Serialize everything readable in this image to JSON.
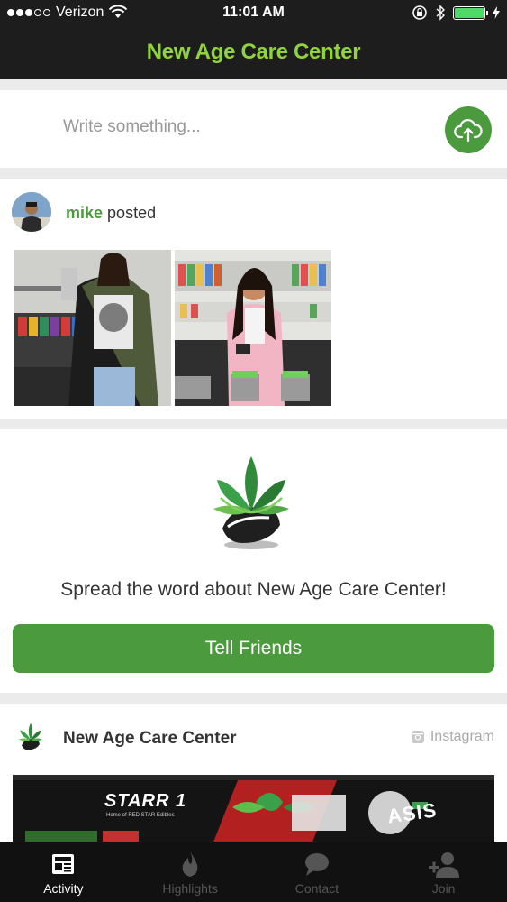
{
  "status_bar": {
    "carrier": "Verizon",
    "time": "11:01 AM",
    "battery_level": 1.0
  },
  "header": {
    "title": "New Age Care Center"
  },
  "composer": {
    "placeholder": "Write something...",
    "upload_icon": "cloud-upload-icon"
  },
  "post": {
    "author": "mike",
    "action": "posted"
  },
  "share": {
    "text": "Spread the word about New Age Care Center!",
    "button_label": "Tell Friends"
  },
  "instagram_post": {
    "account_name": "New Age Care Center",
    "source_label": "Instagram",
    "banner": {
      "starr_title": "STARR 1",
      "starr_subtitle": "Home of RED STAR Edibles",
      "oasis_text": "ASIS"
    }
  },
  "tabs": [
    {
      "label": "Activity",
      "icon": "newspaper-icon",
      "active": true
    },
    {
      "label": "Highlights",
      "icon": "flame-icon",
      "active": false
    },
    {
      "label": "Contact",
      "icon": "chat-bubble-icon",
      "active": false
    },
    {
      "label": "Join",
      "icon": "add-user-icon",
      "active": false
    }
  ],
  "colors": {
    "brand_green": "#4c9a3e",
    "title_green": "#8ed43a",
    "bar_dark": "#1d1d1d"
  }
}
